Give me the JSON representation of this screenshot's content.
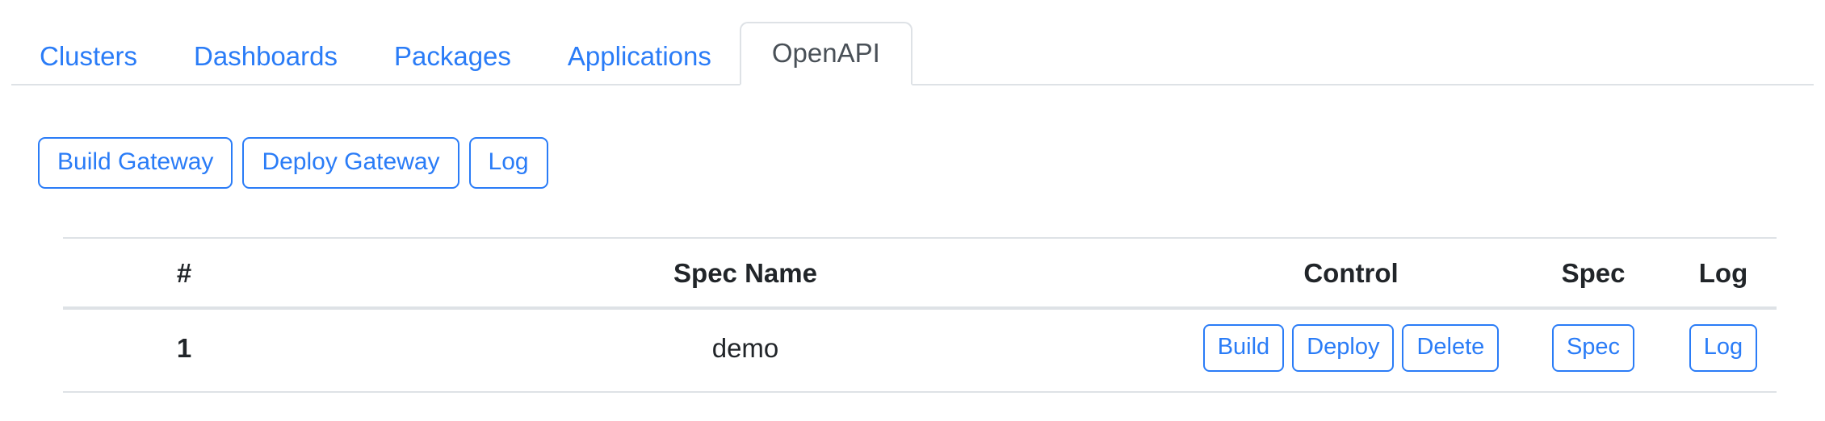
{
  "theme": {
    "link_blue": "#2a7cf7",
    "text_dark": "#212529",
    "border_gray": "#dee2e6",
    "active_tab_text": "#495057",
    "background": "#ffffff"
  },
  "tabs": [
    {
      "label": "Clusters",
      "active": false
    },
    {
      "label": "Dashboards",
      "active": false
    },
    {
      "label": "Packages",
      "active": false
    },
    {
      "label": "Applications",
      "active": false
    },
    {
      "label": "OpenAPI",
      "active": true
    }
  ],
  "toolbar": {
    "build_gateway_label": "Build Gateway",
    "deploy_gateway_label": "Deploy Gateway",
    "log_label": "Log"
  },
  "table": {
    "columns": [
      {
        "key": "num",
        "label": "#"
      },
      {
        "key": "name",
        "label": "Spec Name"
      },
      {
        "key": "control",
        "label": "Control"
      },
      {
        "key": "spec",
        "label": "Spec"
      },
      {
        "key": "log",
        "label": "Log"
      }
    ],
    "rows": [
      {
        "num": "1",
        "name": "demo",
        "control_buttons": [
          "Build",
          "Deploy",
          "Delete"
        ],
        "spec_button": "Spec",
        "log_button": "Log"
      }
    ]
  }
}
